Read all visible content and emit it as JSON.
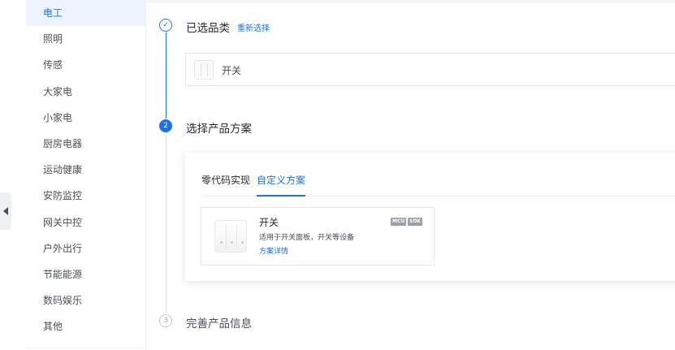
{
  "sidebar": {
    "items": [
      "电工",
      "照明",
      "传感",
      "大家电",
      "小家电",
      "厨房电器",
      "运动健康",
      "安防监控",
      "网关中控",
      "户外出行",
      "节能能源",
      "数码娱乐",
      "其他"
    ],
    "active_index": 0
  },
  "steps": {
    "step1": {
      "icon": "✓",
      "title": "已选品类",
      "reselect": "重新选择",
      "selected_category": "开关"
    },
    "step2": {
      "icon": "2",
      "title": "选择产品方案"
    },
    "step3": {
      "icon": "3",
      "title": "完善产品信息"
    }
  },
  "plan": {
    "tabs": [
      "零代码实现",
      "自定义方案"
    ],
    "active_tab": 1,
    "product": {
      "name": "开关",
      "description": "适用于开关面板，开关等设备",
      "link": "方案详情",
      "badges": [
        "MCU",
        "SDK"
      ]
    }
  },
  "icons": {
    "collapse": "triangle-left-icon",
    "done": "check-icon"
  },
  "colors": {
    "accent": "#1a73e8",
    "active_bg": "#edf4ff"
  }
}
